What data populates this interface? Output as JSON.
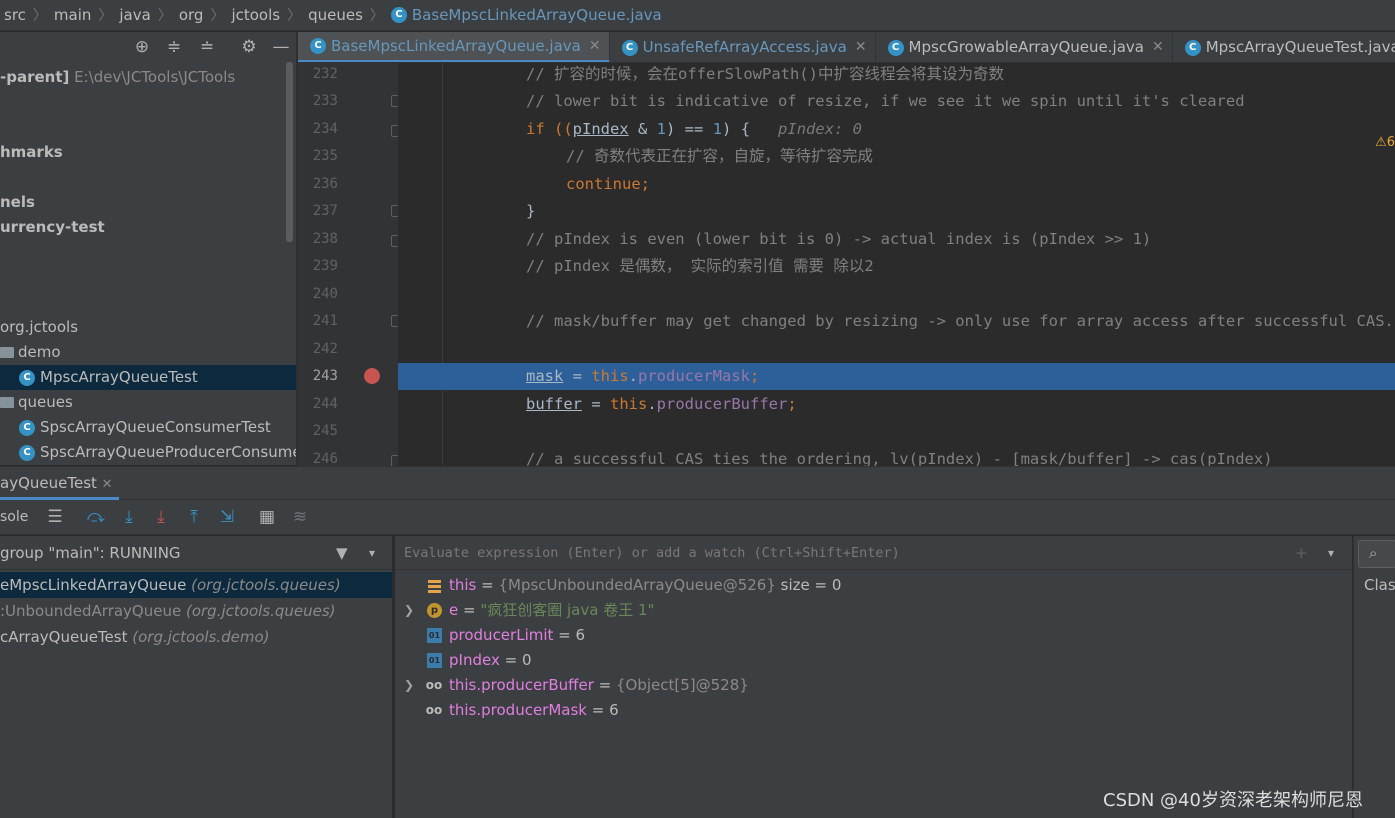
{
  "breadcrumb": [
    "src",
    "main",
    "java",
    "org",
    "jctools",
    "queues",
    "BaseMpscLinkedArrayQueue.java"
  ],
  "project": {
    "rows": [
      {
        "prefix": "-parent]",
        "suffix": "E:\\dev\\JCTools\\JCTools"
      },
      {
        "text": "hmarks"
      },
      {
        "text": "nels"
      },
      {
        "text": "urrency-test"
      },
      {
        "text": "org.jctools"
      },
      {
        "text": "demo"
      },
      {
        "text": "MpscArrayQueueTest"
      },
      {
        "text": "queues"
      },
      {
        "text": "SpscArrayQueueConsumerTest"
      },
      {
        "text": "SpscArrayQueueProducerConsume"
      }
    ]
  },
  "tabs": [
    {
      "label": "BaseMpscLinkedArrayQueue.java",
      "active": true
    },
    {
      "label": "UnsafeRefArrayAccess.java"
    },
    {
      "label": "MpscGrowableArrayQueue.java"
    },
    {
      "label": "MpscArrayQueueTest.java"
    }
  ],
  "editor": {
    "warning_count": "6",
    "lines": [
      "232",
      "233",
      "234",
      "235",
      "236",
      "237",
      "238",
      "239",
      "240",
      "241",
      "242",
      "243",
      "244",
      "245",
      "246"
    ],
    "code": {
      "l232": "// 扩容的时候，会在offerSlowPath()中扩容线程会将其设为奇数",
      "l233": "// lower bit is indicative of resize, if we see it we spin until it's cleared",
      "l234_a": "if ((",
      "l234_b": "pIndex",
      "l234_c": " & ",
      "l234_d": "1",
      "l234_e": ") == ",
      "l234_f": "1",
      "l234_g": ") {",
      "l234_hint": "pIndex: 0",
      "l235": "// 奇数代表正在扩容，自旋，等待扩容完成",
      "l236": "continue;",
      "l237": "}",
      "l238": "// pIndex is even (lower bit is 0) -> actual index is (pIndex >> 1)",
      "l239": "// pIndex 是偶数， 实际的索引值 需要 除以2",
      "l241": "// mask/buffer may get changed by resizing -> only use for array access after successful CAS.",
      "l243_a": "mask",
      "l243_b": " = ",
      "l243_c": "this",
      "l243_d": ".",
      "l243_e": "producerMask",
      "l243_f": ";",
      "l244_a": "buffer",
      "l244_b": " = ",
      "l244_c": "this",
      "l244_d": ".",
      "l244_e": "producerBuffer",
      "l244_f": ";",
      "l246": "// a successful CAS ties the ordering, lv(pIndex) - [mask/buffer] -> cas(pIndex)"
    }
  },
  "debug": {
    "run_tab": "ayQueueTest",
    "console_label": "sole",
    "thread": "group \"main\": RUNNING",
    "frames": [
      {
        "method": "eMpscLinkedArrayQueue",
        "pkg": "(org.jctools.queues)"
      },
      {
        "method": ":UnboundedArrayQueue",
        "pkg": "(org.jctools.queues)"
      },
      {
        "method": "cArrayQueueTest",
        "pkg": "(org.jctools.demo)"
      }
    ],
    "eval_placeholder": "Evaluate expression (Enter) or add a watch (Ctrl+Shift+Enter)",
    "variables": [
      {
        "name": "this",
        "eq": " = ",
        "value": "{MpscUnboundedArrayQueue@526}",
        "extra": " size = 0"
      },
      {
        "name": "e",
        "eq": " = ",
        "value": "\"疯狂创客圈 java 卷王 1\""
      },
      {
        "name": "producerLimit",
        "eq": " = ",
        "value": "6"
      },
      {
        "name": "pIndex",
        "eq": " = ",
        "value": "0"
      },
      {
        "name": "this.producerBuffer",
        "eq": " = ",
        "value": "{Object[5]@528}"
      },
      {
        "name": "this.producerMask",
        "eq": " = ",
        "value": "6"
      }
    ],
    "right_label": "Class"
  },
  "watermark": "CSDN @40岁资深老架构师尼恩"
}
